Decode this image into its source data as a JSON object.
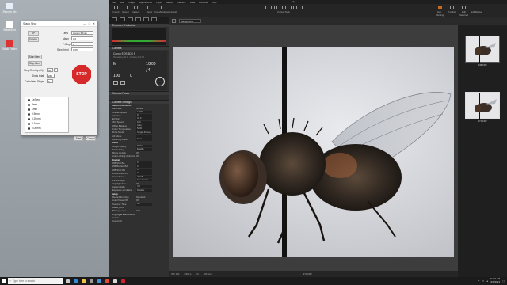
{
  "desktop": {
    "icons": [
      {
        "label": "Recycle Bin",
        "icon": "recycle-bin-icon"
      },
      {
        "label": "Stack Shot",
        "icon": "app-icon"
      },
      {
        "label": "Stack Folder",
        "icon": "folder-icon"
      }
    ]
  },
  "dialog": {
    "title": "Stack Shot",
    "window_controls": [
      "—",
      "□",
      "✕"
    ],
    "buttons": {
      "up": "UP",
      "down": "DOWN",
      "start_here": "Start Here",
      "stop_here": "Stop Here",
      "start": "Start",
      "cancel": "Cancel",
      "stop": "STOP"
    },
    "fields": {
      "lens_label": "Lens",
      "lens_value": "Canon 65mm MPE",
      "mag_label": "Magn",
      "mag_value": "3.0",
      "fstop_label": "F-Stop",
      "fstop_value": "8",
      "step_label": "Step (mm)",
      "step_value": "0.05",
      "overlap_label": "Step Overlap (%):",
      "overlap_value": "30",
      "shots_label": "Shots total:",
      "shots_value": "260",
      "calc_label": "Calculated Steps:",
      "calc_value": "0"
    },
    "radio_options": [
      "1xStep",
      "2mm",
      "1mm",
      "0.5mm",
      "0.25mm",
      "0.1mm",
      "0.05mm"
    ],
    "radio_selected_index": 0
  },
  "capture_one": {
    "window_title": "Fly",
    "menu": [
      "File",
      "Edit",
      "Image",
      "Adjustments",
      "Layer",
      "Select",
      "Camera",
      "View",
      "Window",
      "Help"
    ],
    "toolbar_left": [
      "Import",
      "Export",
      "Capture"
    ],
    "toolbar_left2": [
      "Reset",
      "Undo/Redo",
      "Auto Adjust"
    ],
    "cursor_tools_label": "Cursor Tools",
    "toolbar_right": [
      "Exp. Warning",
      "Proofing",
      "Edit Selected",
      "Edit Master"
    ],
    "panels": {
      "exposure": "Exposure Evaluation",
      "camera": "Camera",
      "camera_focus": "Camera Focus",
      "camera_settings": "Camera Settings"
    },
    "camera": {
      "model": "Canon EOS 5DS R",
      "status": "Remaining 44 k · 1 Battery Bat 62",
      "mode": "M",
      "shutter": "1/200",
      "aperture": "ƒ4",
      "iso": "100",
      "ev": "0"
    },
    "settings_header": "Canon EOS 5DS R",
    "settings": [
      {
        "k": "AE Mode",
        "v": "Manual",
        "box": false
      },
      {
        "k": "Shutter Speed",
        "v": "1/200",
        "box": true
      },
      {
        "k": "Aperture",
        "v": "f/4",
        "box": true
      },
      {
        "k": "EV Adj",
        "v": "±0.0",
        "box": true
      },
      {
        "k": "ISO Speed",
        "v": "100",
        "box": true
      },
      {
        "k": "White Balance",
        "v": "Auto",
        "box": true
      },
      {
        "k": "Color Temperature",
        "v": "5200",
        "box": true
      },
      {
        "k": "Drive Mode",
        "v": "Single-Frame",
        "box": true
      },
      {
        "k": "AF Mode",
        "v": "",
        "box": true
      },
      {
        "k": "Metering Mode",
        "v": "Spot",
        "box": true
      },
      {
        "k": "Shoot",
        "v": "",
        "sec": true
      },
      {
        "k": "Image Quality",
        "v": "RAW",
        "box": true
      },
      {
        "k": "Flash Firing",
        "v": "Enable",
        "box": true
      },
      {
        "k": "Mirror Lockup",
        "v": "Off",
        "box": false
      },
      {
        "k": "Auto Lighting Optimizer",
        "v": "Off",
        "box": false
      },
      {
        "k": "Bracket",
        "v": "",
        "sec": true
      },
      {
        "k": "WB Shift BA",
        "v": "0",
        "box": true
      },
      {
        "k": "WB Bracket BA",
        "v": "0",
        "box": true
      },
      {
        "k": "WB Shift MG",
        "v": "0",
        "box": true
      },
      {
        "k": "WB Bracket MG",
        "v": "0",
        "box": true
      },
      {
        "k": "Color Space",
        "v": "sRGB",
        "box": true
      },
      {
        "k": "Picture Style",
        "v": "Fine Detail",
        "box": true
      },
      {
        "k": "Highlight Tone",
        "v": "Off",
        "box": false
      },
      {
        "k": "Aspect Ratio",
        "v": "3:2",
        "box": true
      },
      {
        "k": "Exposure simulation",
        "v": "Disable",
        "box": true
      },
      {
        "k": "Setup",
        "v": "",
        "sec": true
      },
      {
        "k": "Record Function",
        "v": "Standard",
        "box": false
      },
      {
        "k": "Auto Power Off",
        "v": "Off",
        "box": false
      },
      {
        "k": "Summer Time",
        "v": "Off",
        "box": true
      },
      {
        "k": "Battery Info",
        "v": "",
        "box": false
      },
      {
        "k": "Battery Level",
        "v": "100",
        "box": false
      },
      {
        "k": "Copyright Information",
        "v": "",
        "sec": true
      },
      {
        "k": "Author",
        "v": "",
        "box": false
      },
      {
        "k": "Copyright",
        "v": "",
        "box": false
      }
    ],
    "viewer": {
      "dropdown": "Background",
      "status": [
        "ISO 100",
        "1/200 s",
        "f/4",
        "100 mm",
        "271.CR2"
      ]
    },
    "thumbs": [
      "248.CR2",
      "271.CR2"
    ]
  },
  "taskbar": {
    "search_placeholder": "Type here to search",
    "time": "11:59 AM",
    "date": "6/1/2021",
    "apps": [
      {
        "name": "task-view-icon",
        "color": "#cccccc"
      },
      {
        "name": "edge-icon",
        "color": "#2f89d6"
      },
      {
        "name": "file-explorer-icon",
        "color": "#f2c04a"
      },
      {
        "name": "store-icon",
        "color": "#9a9a9a"
      },
      {
        "name": "mail-icon",
        "color": "#4a8fd6"
      },
      {
        "name": "chrome-icon",
        "color": "#e04a3a"
      },
      {
        "name": "capture-one-icon",
        "color": "#d7d7d7"
      },
      {
        "name": "stackshot-icon",
        "color": "#c23"
      }
    ]
  }
}
